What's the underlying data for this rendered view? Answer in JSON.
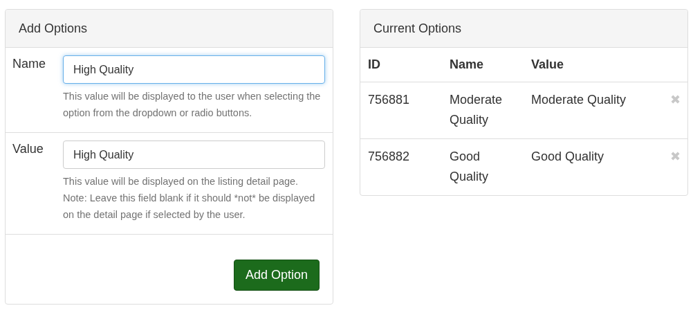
{
  "add_panel": {
    "title": "Add Options",
    "fields": [
      {
        "label": "Name",
        "value": "High Quality",
        "focused": true,
        "help": [
          "This value will be displayed to the user when selecting the option from the dropdown or radio buttons."
        ]
      },
      {
        "label": "Value",
        "value": "High Quality",
        "focused": false,
        "help": [
          "This value will be displayed on the listing detail page.",
          "Note: Leave this field blank if it should *not* be displayed on the detail page if selected by the user."
        ]
      }
    ],
    "button": "Add Option"
  },
  "current_panel": {
    "title": "Current Options",
    "columns": [
      "ID",
      "Name",
      "Value"
    ],
    "rows": [
      {
        "id": "756881",
        "name": "Moderate Quality",
        "value": "Moderate Quality",
        "delete": "✖"
      },
      {
        "id": "756882",
        "name": "Good Quality",
        "value": "Good Quality",
        "delete": "✖"
      }
    ]
  }
}
